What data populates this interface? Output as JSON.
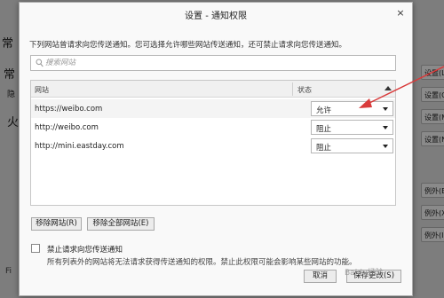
{
  "background": {
    "left_items": [
      "常",
      "常",
      "隐",
      "火"
    ],
    "right_buttons": [
      "设置(L)...",
      "设置(C)...",
      "设置(M)...",
      "设置(N)...",
      "例外(E)...",
      "例外(X)...",
      "例外(I)..."
    ],
    "footer_prefix": "Fi"
  },
  "dialog": {
    "title": "设置 - 通知权限",
    "close_label": "×",
    "description": "下列网站曾请求向您传送通知。您可选择允许哪些网站传送通知，还可禁止请求向您传送通知。",
    "search_placeholder": "搜索网站",
    "table": {
      "columns": {
        "site": "网站",
        "status": "状态"
      },
      "rows": [
        {
          "site": "https://weibo.com",
          "status": "允许"
        },
        {
          "site": "http://weibo.com",
          "status": "阻止"
        },
        {
          "site": "http://mini.eastday.com",
          "status": "阻止"
        }
      ]
    },
    "remove_site": "移除网站(R)",
    "remove_all": "移除全部网站(E)",
    "block_label": "禁止请求向您传送通知",
    "block_desc": "所有列表外的网站将无法请求获得传送通知的权限。禁止此权限可能会影响某些网站的功能。",
    "cancel": "取消",
    "save": "保存更改(S)"
  },
  "watermark": "Baidu经验",
  "colors": {
    "arrow": "#d93a3a",
    "dim_overlay": "#7d7d7d"
  }
}
